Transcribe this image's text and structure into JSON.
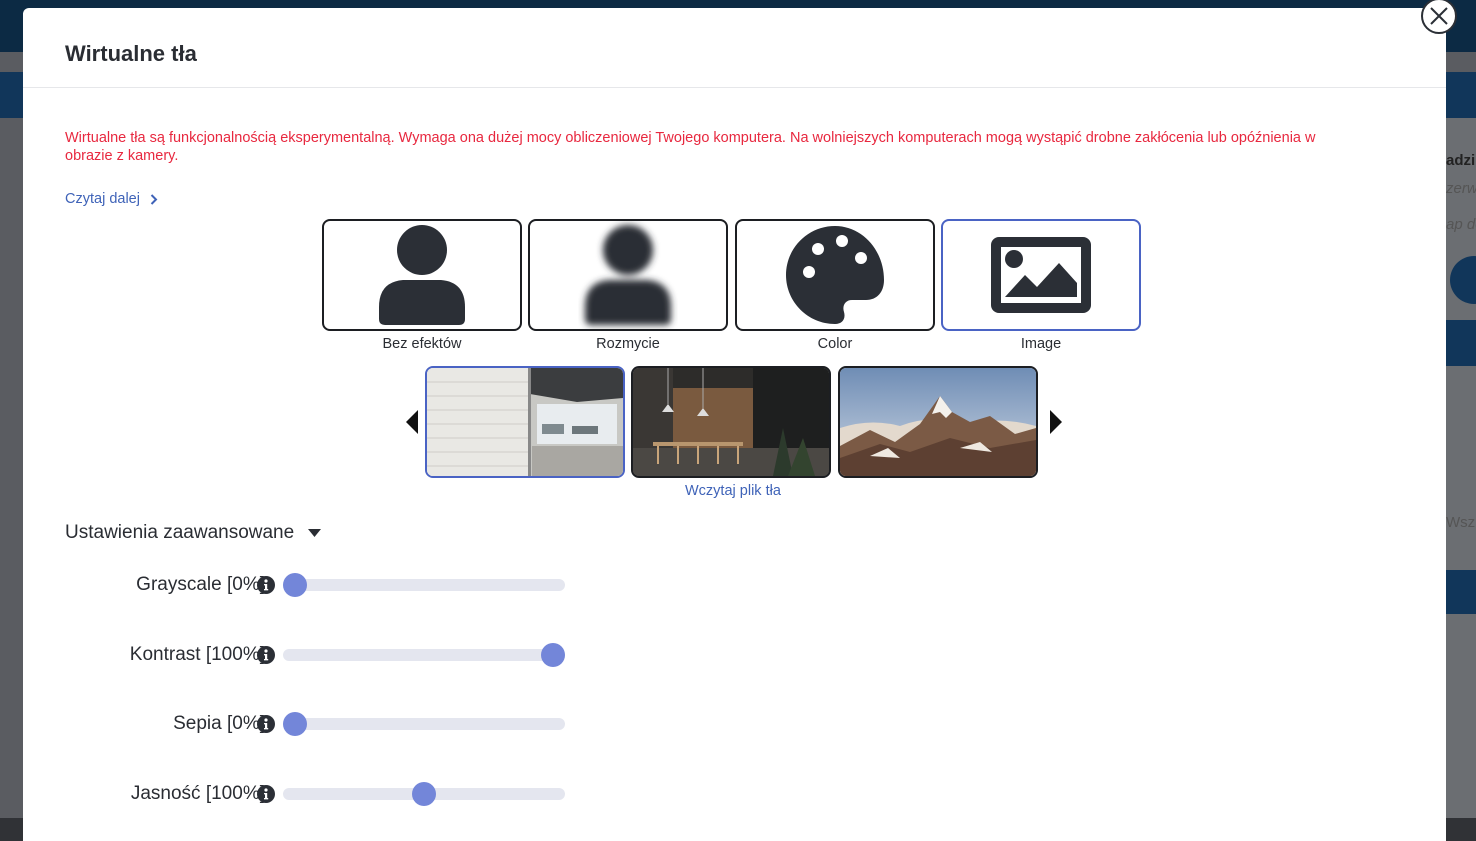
{
  "background_app": {
    "right_texts": [
      "adzi",
      "zerw",
      "ap do",
      "Wsz"
    ]
  },
  "modal": {
    "title": "Wirtualne tła",
    "close_icon": "close-icon",
    "warning": "Wirtualne tła są funkcjonalnością eksperymentalną. Wymaga ona dużej mocy obliczeniowej Twojego komputera. Na wolniejszych komputerach mogą wystąpić drobne zakłócenia lub opóźnienia w obrazie z kamery.",
    "read_more": "Czytaj dalej",
    "options": [
      {
        "label": "Bez efektów",
        "icon": "user-icon",
        "selected": false
      },
      {
        "label": "Rozmycie",
        "icon": "blurred-user-icon",
        "selected": false
      },
      {
        "label": "Color",
        "icon": "palette-icon",
        "selected": false
      },
      {
        "label": "Image",
        "icon": "image-icon",
        "selected": true
      }
    ],
    "thumbnails": [
      {
        "name": "office",
        "selected": true
      },
      {
        "name": "kitchen",
        "selected": false
      },
      {
        "name": "mountains",
        "selected": false
      }
    ],
    "upload_label": "Wczytaj plik tła",
    "advanced_label": "Ustawienia zaawansowane",
    "sliders": [
      {
        "label": "Grayscale [0%]",
        "value": 0
      },
      {
        "label": "Kontrast [100%]",
        "value": 1.0
      },
      {
        "label": "Sepia [0%]",
        "value": 0
      },
      {
        "label": "Jasność [100%]",
        "value": 0.5
      }
    ]
  },
  "colors": {
    "accent": "#4a63c4",
    "warning": "#e8283f",
    "link": "#3f63b8",
    "slider_thumb": "#7386d9",
    "slider_track": "#e4e6ef",
    "icon_dark": "#2b2f36"
  }
}
